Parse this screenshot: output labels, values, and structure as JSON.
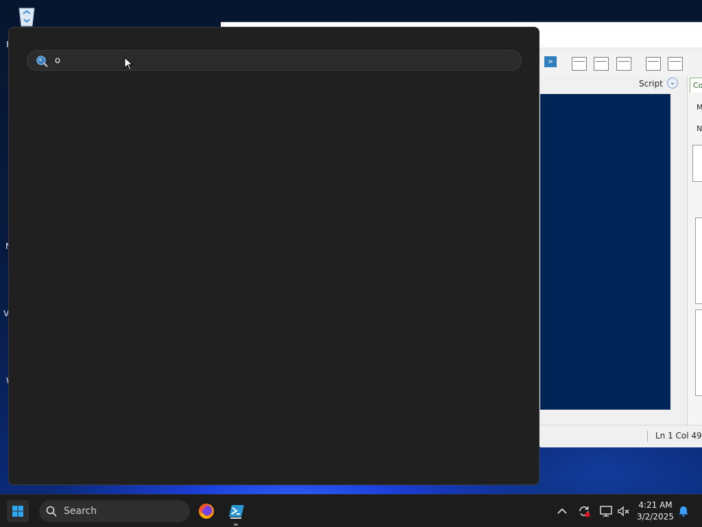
{
  "search_flyout": {
    "query": "o"
  },
  "ise_window": {
    "script_label": "Script",
    "side_tab_label": "Co",
    "side_letters": [
      "M",
      "N"
    ],
    "status": "Ln 1  Col 49"
  },
  "desktop": {
    "edge_letters": [
      "F",
      "I",
      "N",
      "V",
      "W"
    ]
  },
  "taskbar": {
    "search_label": "Search",
    "clock_time": "4:21 AM",
    "clock_date": "3/2/2025"
  },
  "colors": {
    "accent": "#0078d4",
    "flyout_bg": "#202020",
    "script_pane_bg": "#012456"
  },
  "icons": {
    "start": "windows-logo-icon",
    "apps": [
      "firefox-icon",
      "powershell-ise-icon"
    ],
    "tray": [
      "chevron-up-icon",
      "sync-alert-icon",
      "network-icon",
      "volume-muted-icon",
      "notification-bell-icon"
    ]
  }
}
